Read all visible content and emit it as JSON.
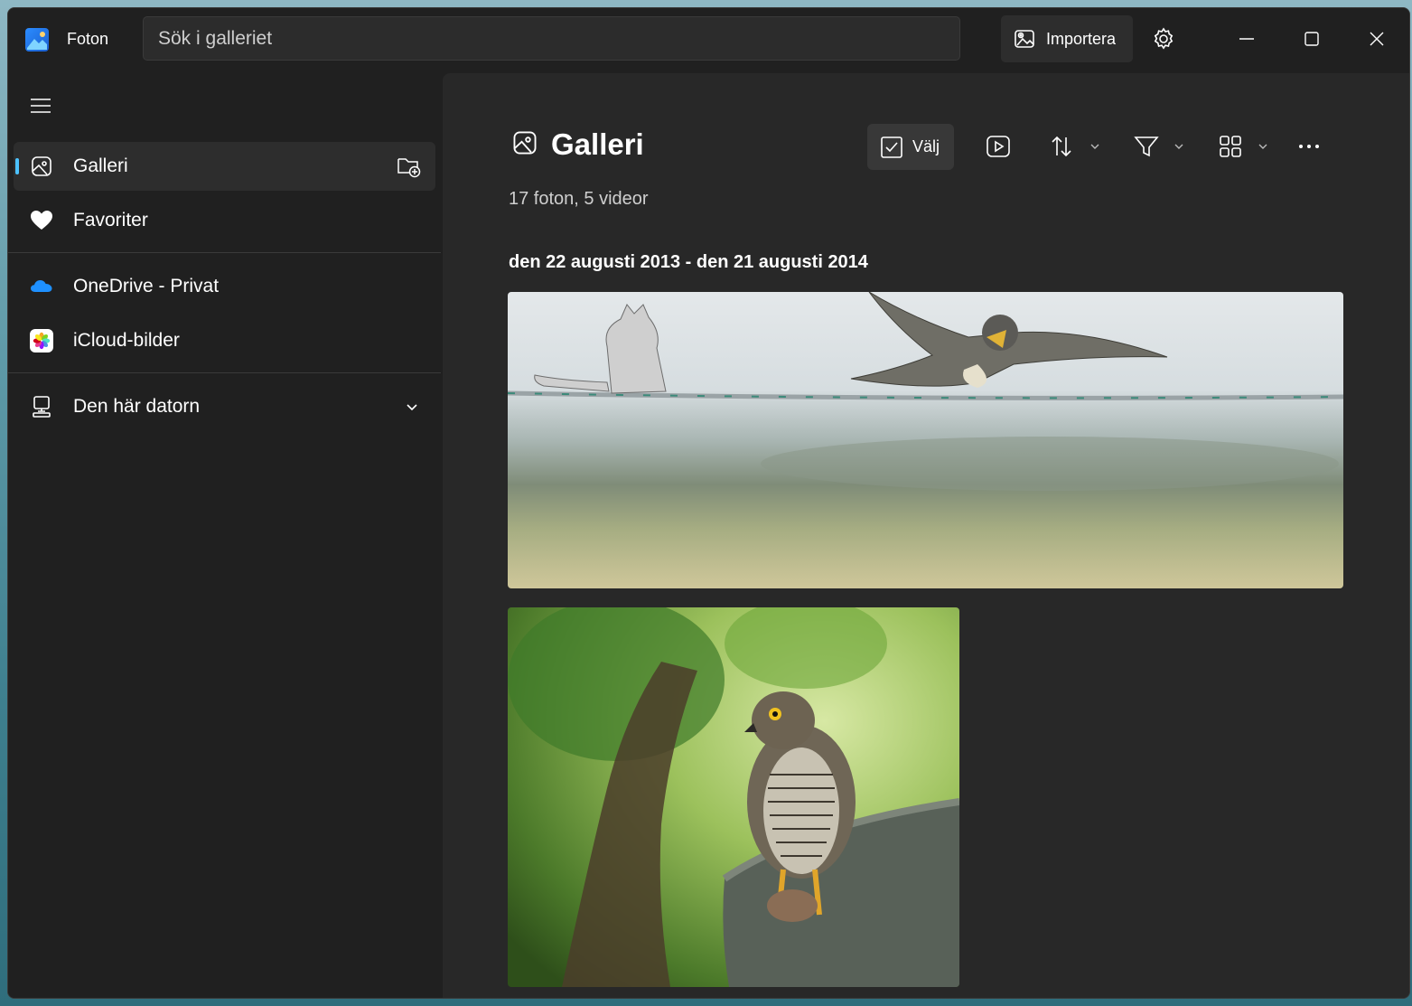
{
  "app": {
    "title": "Foton"
  },
  "search": {
    "placeholder": "Sök i galleriet"
  },
  "titlebar": {
    "import_label": "Importera"
  },
  "sidebar": {
    "items": [
      {
        "label": "Galleri",
        "icon": "gallery-icon",
        "active": true
      },
      {
        "label": "Favoriter",
        "icon": "heart-icon"
      },
      {
        "label": "OneDrive - Privat",
        "icon": "onedrive-cloud-icon"
      },
      {
        "label": "iCloud-bilder",
        "icon": "icloud-photos-icon"
      },
      {
        "label": "Den här datorn",
        "icon": "computer-icon"
      }
    ]
  },
  "main": {
    "title": "Galleri",
    "subtitle": "17 foton, 5 videor",
    "toolbar": {
      "select_label": "Välj"
    },
    "date_range": "den 22 augusti 2013 - den 21 augusti 2014"
  },
  "colors": {
    "accent": "#4cc2ff",
    "window_bg": "#202020",
    "content_bg": "#282828"
  }
}
